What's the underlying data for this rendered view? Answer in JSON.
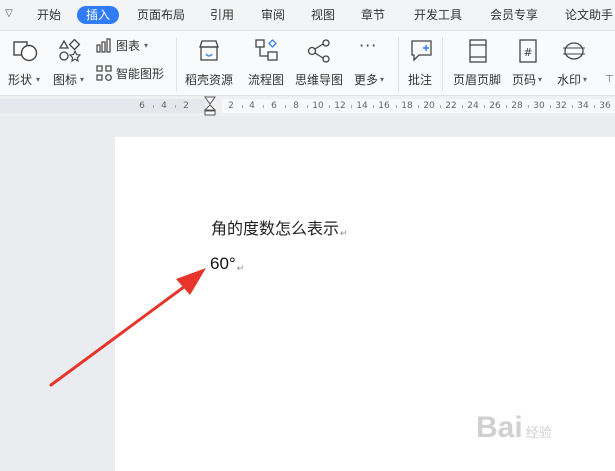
{
  "menu": {
    "tabs": [
      {
        "label": "开始"
      },
      {
        "label": "插入"
      },
      {
        "label": "页面布局"
      },
      {
        "label": "引用"
      },
      {
        "label": "审阅"
      },
      {
        "label": "视图"
      },
      {
        "label": "章节"
      },
      {
        "label": "开发工具"
      },
      {
        "label": "会员专享"
      },
      {
        "label": "论文助手"
      }
    ],
    "active_tab": "插入"
  },
  "ribbon": {
    "shape": "形状",
    "icon": "图标",
    "chart": "图表",
    "smartart": "智能图形",
    "resources": "稻壳资源",
    "flowchart": "流程图",
    "mindmap": "思维导图",
    "more": "更多",
    "comment": "批注",
    "header_footer": "页眉页脚",
    "page_number": "页码",
    "watermark": "水印"
  },
  "ruler": {
    "labels": [
      "6",
      "4",
      "2",
      "2",
      "4",
      "6",
      "8",
      "10",
      "12",
      "14",
      "16",
      "18",
      "20",
      "22",
      "24",
      "26",
      "28",
      "30",
      "32",
      "34",
      "36"
    ]
  },
  "document": {
    "line1": "角的度数怎么表示",
    "line2": "60°",
    "paragraph_mark": "↵"
  },
  "watermark": {
    "brand": "Bai",
    "suffix": "经验"
  },
  "colors": {
    "accent": "#2f7cf6",
    "arrow": "#e8352b"
  }
}
